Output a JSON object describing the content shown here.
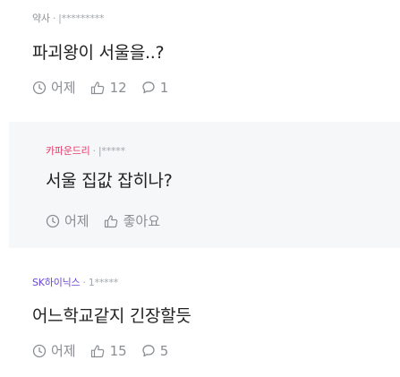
{
  "posts": [
    {
      "company": "약사",
      "user_id": "|*********",
      "title": "파괴왕이 서울을..?",
      "time": "어제",
      "likes": "12",
      "comments": "1"
    },
    {
      "company": "카파운드리",
      "user_id": "|*****",
      "title": "서울 집값 잡히나?",
      "time": "어제",
      "likes": "좋아요",
      "comments": ""
    },
    {
      "company": "SK하이닉스",
      "user_id": "1*****",
      "title": "어느학교같지 긴장할듯",
      "time": "어제",
      "likes": "15",
      "comments": "5"
    }
  ],
  "colors": {
    "company_default": "#8a8e93",
    "company_pink": "#e6396b",
    "company_purple": "#6a45d8",
    "highlight_bg": "#f6f7f9"
  },
  "icons": {
    "time": "clock-icon",
    "like": "thumbs-up-icon",
    "comment": "speech-bubble-icon"
  }
}
